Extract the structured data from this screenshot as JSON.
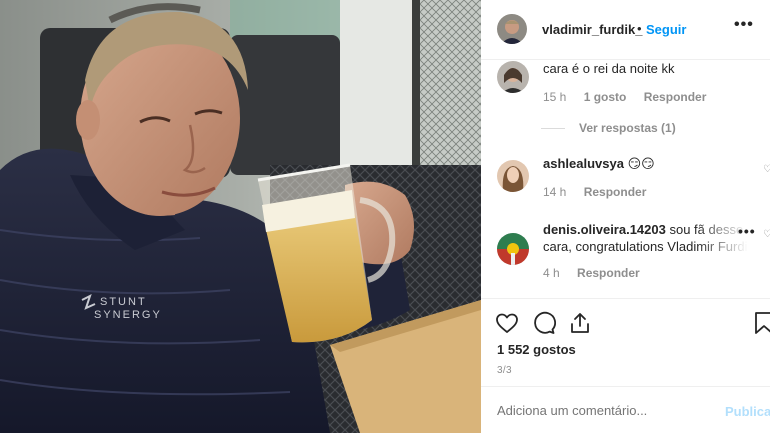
{
  "post": {
    "photo_logo_line1": "STUNT",
    "photo_logo_line2": "SYNERGY"
  },
  "header": {
    "username": "vladimir_furdik_",
    "separator": "•",
    "follow_label": "Seguir",
    "more_icon": "more-horizontal-icon"
  },
  "comments": [
    {
      "username": "",
      "text": "cara é o rei da noite kk",
      "time": "15 h",
      "likes": "1 gosto",
      "reply_label": "Responder"
    },
    {
      "view_replies": "Ver respostas (1)"
    },
    {
      "username": "ashlealuvsya",
      "text": "😏😏",
      "time": "14 h",
      "reply_label": "Responder"
    },
    {
      "username": "denis.oliveira.14203",
      "text_line1": "sou fã desse",
      "text_line2": "cara, congratulations Vladimir Furdik",
      "time": "4 h",
      "reply_label": "Responder"
    }
  ],
  "actions": {
    "like_icon": "heart-icon",
    "comment_icon": "comment-icon",
    "share_icon": "share-icon",
    "save_icon": "bookmark-icon",
    "likes_count": "1 552 gostos",
    "page_indicator": "3/3"
  },
  "add_comment": {
    "placeholder": "Adiciona um comentário...",
    "post_label": "Publicar"
  },
  "colors": {
    "link_blue": "#0095f6",
    "muted": "#8e8e8e",
    "post_disabled": "#b2dffc"
  }
}
